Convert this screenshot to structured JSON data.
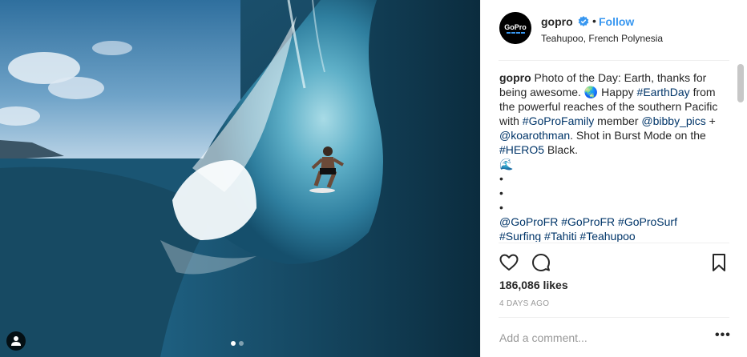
{
  "post": {
    "username": "gopro",
    "follow_label": "Follow",
    "bullet": "•",
    "location": "Teahupoo, French Polynesia",
    "avatar_text": "GoPro",
    "caption": {
      "author": "gopro",
      "segments": [
        {
          "t": "Photo of the Day: Earth, thanks for being awesome. "
        },
        {
          "t": "🌏"
        },
        {
          "t": " Happy "
        },
        {
          "t": "#EarthDay",
          "link": true
        },
        {
          "t": " from the powerful reaches of the southern Pacific with "
        },
        {
          "t": "#GoProFamily",
          "link": true
        },
        {
          "t": " member "
        },
        {
          "t": "@bibby_pics",
          "link": true
        },
        {
          "t": " + "
        },
        {
          "t": "@koarothman",
          "link": true
        },
        {
          "t": ". Shot in Burst Mode on the "
        },
        {
          "t": "#HERO5",
          "link": true
        },
        {
          "t": " Black."
        },
        {
          "br": true
        },
        {
          "t": "🌊"
        },
        {
          "br": true
        },
        {
          "t": "•"
        },
        {
          "br": true
        },
        {
          "t": "•"
        },
        {
          "br": true
        },
        {
          "t": "•"
        },
        {
          "br": true
        },
        {
          "t": "@GoProFR",
          "link": true
        },
        {
          "t": " "
        },
        {
          "t": "#GoProFR",
          "link": true
        },
        {
          "t": " "
        },
        {
          "t": "#GoProSurf",
          "link": true
        },
        {
          "br": true
        },
        {
          "t": "#Surfing",
          "link": true
        },
        {
          "t": " "
        },
        {
          "t": "#Tahiti",
          "link": true
        },
        {
          "t": " "
        },
        {
          "t": "#Teahupoo",
          "link": true
        }
      ]
    },
    "likes": "186,086 likes",
    "time_ago": "4 DAYS AGO",
    "comment_placeholder": "Add a comment...",
    "more_label": "•••",
    "carousel": {
      "count": 2,
      "active": 0
    },
    "colors": {
      "link": "#003569",
      "follow": "#3897f0",
      "verified": "#3897f0",
      "muted": "#999999",
      "text": "#262626"
    },
    "icons": {
      "like": "heart-icon",
      "comment": "comment-bubble-icon",
      "save": "bookmark-icon",
      "tag": "user-tag-icon",
      "verified": "verified-badge-icon"
    }
  }
}
